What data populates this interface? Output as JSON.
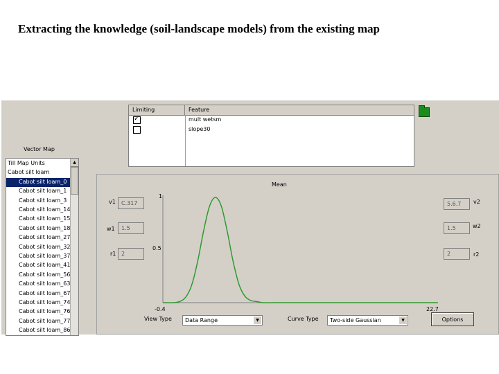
{
  "slide": {
    "title": "Extracting the knowledge (soil-landscape models) from the existing map"
  },
  "features": {
    "headers": [
      "Limiting",
      "Feature"
    ],
    "rows": [
      {
        "checked": true,
        "name": "mult wetsm"
      },
      {
        "checked": false,
        "name": "slope30"
      }
    ],
    "open_icon": "folder-icon"
  },
  "vector_map": {
    "label": "Vector Map",
    "items": [
      {
        "label": "Till Map Units",
        "level": 0
      },
      {
        "label": "Cabot silt loam",
        "level": 0
      },
      {
        "label": "Cabot silt loam_0",
        "level": 1,
        "selected": true
      },
      {
        "label": "Cabot silt loam_1",
        "level": 1
      },
      {
        "label": "Cabot silt loam_3",
        "level": 1
      },
      {
        "label": "Cabot silt loam_14",
        "level": 1
      },
      {
        "label": "Cabot silt loam_15",
        "level": 1
      },
      {
        "label": "Cabot silt loam_18",
        "level": 1
      },
      {
        "label": "Cabot silt loam_27",
        "level": 1
      },
      {
        "label": "Cabot silt loam_32",
        "level": 1
      },
      {
        "label": "Cabot silt loam_37",
        "level": 1
      },
      {
        "label": "Cabot silt loam_41",
        "level": 1
      },
      {
        "label": "Cabot silt loam_56",
        "level": 1
      },
      {
        "label": "Cabot silt loam_63",
        "level": 1
      },
      {
        "label": "Cabot silt loam_67",
        "level": 1
      },
      {
        "label": "Cabot silt loam_74",
        "level": 1
      },
      {
        "label": "Cabot silt loam_76",
        "level": 1
      },
      {
        "label": "Cabot silt loam_77",
        "level": 1
      },
      {
        "label": "Cabot silt loam_86",
        "level": 1
      }
    ]
  },
  "curve": {
    "title": "Mean",
    "left_params": [
      {
        "label": "v1",
        "value": "C.317"
      },
      {
        "label": "w1",
        "value": "1.5"
      },
      {
        "label": "r1",
        "value": "2"
      }
    ],
    "right_params": [
      {
        "label": "v2",
        "value": "5.6.7"
      },
      {
        "label": "w2",
        "value": "1.5"
      },
      {
        "label": "r2",
        "value": "2"
      }
    ],
    "y_ticks": [
      "1",
      "0.5"
    ],
    "x_min_label": "-0.4",
    "x_max_label": "22.7",
    "line_color": "#2e9a2e"
  },
  "chart_data": {
    "type": "line",
    "title": "Mean",
    "x": [
      -0.4,
      0.5,
      1.0,
      1.5,
      2.0,
      2.5,
      3.0,
      3.5,
      4.0,
      4.5,
      5.0,
      5.5,
      6.0,
      6.5,
      7.0,
      7.5,
      8.0,
      9.0,
      12.0,
      16.0,
      22.7
    ],
    "y": [
      0.0,
      0.0,
      0.01,
      0.05,
      0.16,
      0.38,
      0.67,
      0.91,
      1.0,
      0.92,
      0.68,
      0.39,
      0.17,
      0.06,
      0.02,
      0.01,
      0.0,
      0.0,
      0.0,
      0.0,
      0.0
    ],
    "xlim": [
      -0.4,
      22.7
    ],
    "ylim": [
      0,
      1
    ],
    "grid": false
  },
  "controls": {
    "view_type_label": "View Type",
    "view_type_value": "Data Range",
    "curve_type_label": "Curve Type",
    "curve_type_value": "Two-side Gaussian",
    "options_label": "Options"
  }
}
